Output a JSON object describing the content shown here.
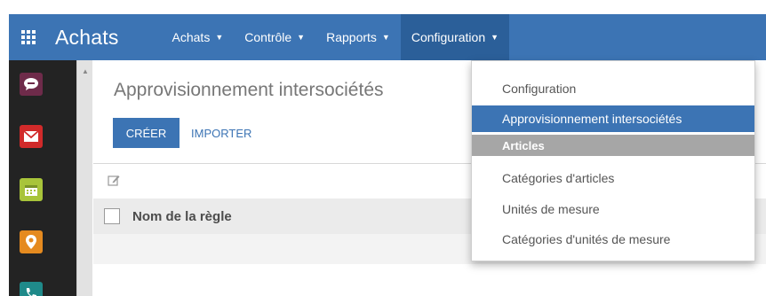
{
  "navbar": {
    "app_title": "Achats",
    "menu": [
      {
        "label": "Achats"
      },
      {
        "label": "Contrôle"
      },
      {
        "label": "Rapports"
      },
      {
        "label": "Configuration"
      }
    ],
    "caret": "▼",
    "color": "#3c74b4",
    "active_color": "#2b5f99"
  },
  "sidebar": {
    "apps": [
      {
        "icon": "chat-icon",
        "color": "#6e2b4a"
      },
      {
        "icon": "mail-icon",
        "color": "#d12a2a"
      },
      {
        "icon": "calendar-icon",
        "color": "#a8c43a"
      },
      {
        "icon": "location-pin-icon",
        "color": "#e58a1f"
      },
      {
        "icon": "phone-icon",
        "color": "#1f8a8a"
      }
    ]
  },
  "page": {
    "title": "Approvisionnement intersociétés",
    "create_label": "CRÉER",
    "import_label": "IMPORTER",
    "column_name": "Nom de la règle"
  },
  "dropdown": {
    "items": [
      {
        "label": "Configuration",
        "state": "normal"
      },
      {
        "label": "Approvisionnement intersociétés",
        "state": "highlight"
      },
      {
        "label": "Articles",
        "state": "header"
      },
      {
        "label": "Catégories d'articles",
        "state": "normal"
      },
      {
        "label": "Unités de mesure",
        "state": "normal"
      },
      {
        "label": "Catégories d'unités de mesure",
        "state": "normal"
      }
    ]
  }
}
